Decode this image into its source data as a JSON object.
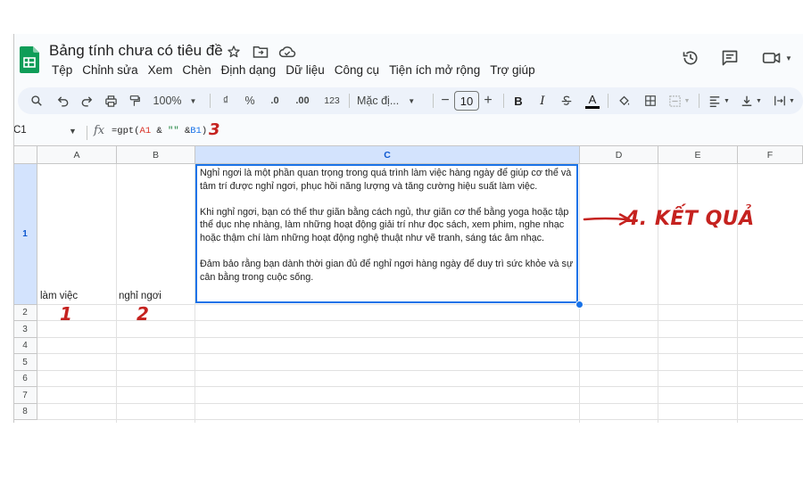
{
  "doc_title": "Bảng tính chưa có tiêu đề",
  "menu": [
    "Tệp",
    "Chỉnh sửa",
    "Xem",
    "Chèn",
    "Định dạng",
    "Dữ liệu",
    "Công cụ",
    "Tiện ích mở rộng",
    "Trợ giúp"
  ],
  "title_icons": [
    "star-icon",
    "move-to-folder-icon",
    "cloud-status-icon"
  ],
  "right_icons": [
    "version-history-icon",
    "comments-icon",
    "meet-icon"
  ],
  "toolbar": {
    "zoom": "100%",
    "currency": "₫",
    "percent": "%",
    "decrease_decimal": ".0",
    "increase_decimal": ".00",
    "more_formats": "123",
    "font": "Mặc đị...",
    "font_size": "10",
    "bold": "B",
    "italic": "I",
    "text_color": "A"
  },
  "formula_bar": {
    "name_box": "C1",
    "fx": "fx",
    "formula_prefix": "=gpt(",
    "ref1": "A1",
    "formula_mid": " & ",
    "string_lit": "\"\"",
    "formula_mid2": " &",
    "ref2": "B1",
    "formula_suffix": ")"
  },
  "columns": [
    "A",
    "B",
    "C",
    "D",
    "E",
    "F"
  ],
  "rows": [
    "1",
    "2",
    "3",
    "4",
    "5",
    "6",
    "7",
    "8"
  ],
  "cells": {
    "A1": "làm việc",
    "B1": "nghỉ ngơi",
    "C1_paragraphs": [
      "Nghỉ ngơi là một phần quan trọng trong quá trình làm việc hàng ngày để giúp cơ thể và tâm trí được nghỉ ngơi, phục hồi năng lượng và tăng cường hiệu suất làm việc.",
      "Khi nghỉ ngơi, bạn có thể thư giãn bằng cách ngủ, thư giãn cơ thể bằng yoga hoặc tập thể dục nhẹ nhàng, làm những hoạt động giải trí như đọc sách, xem phim, nghe nhạc hoặc thậm chí làm những hoạt động nghệ thuật như vẽ tranh, sáng tác âm nhạc.",
      "Đảm bảo rằng bạn dành thời gian đủ để nghỉ ngơi hàng ngày để duy trì sức khỏe và sự cân bằng trong cuộc sống."
    ]
  },
  "annotations": {
    "step1": "1",
    "step2": "2",
    "step3": "3",
    "result": "4. KẾT QUẢ"
  },
  "colors": {
    "brand_green": "#0f9d58",
    "selection_blue": "#1a73e8",
    "annotation_red": "#c5221f"
  }
}
